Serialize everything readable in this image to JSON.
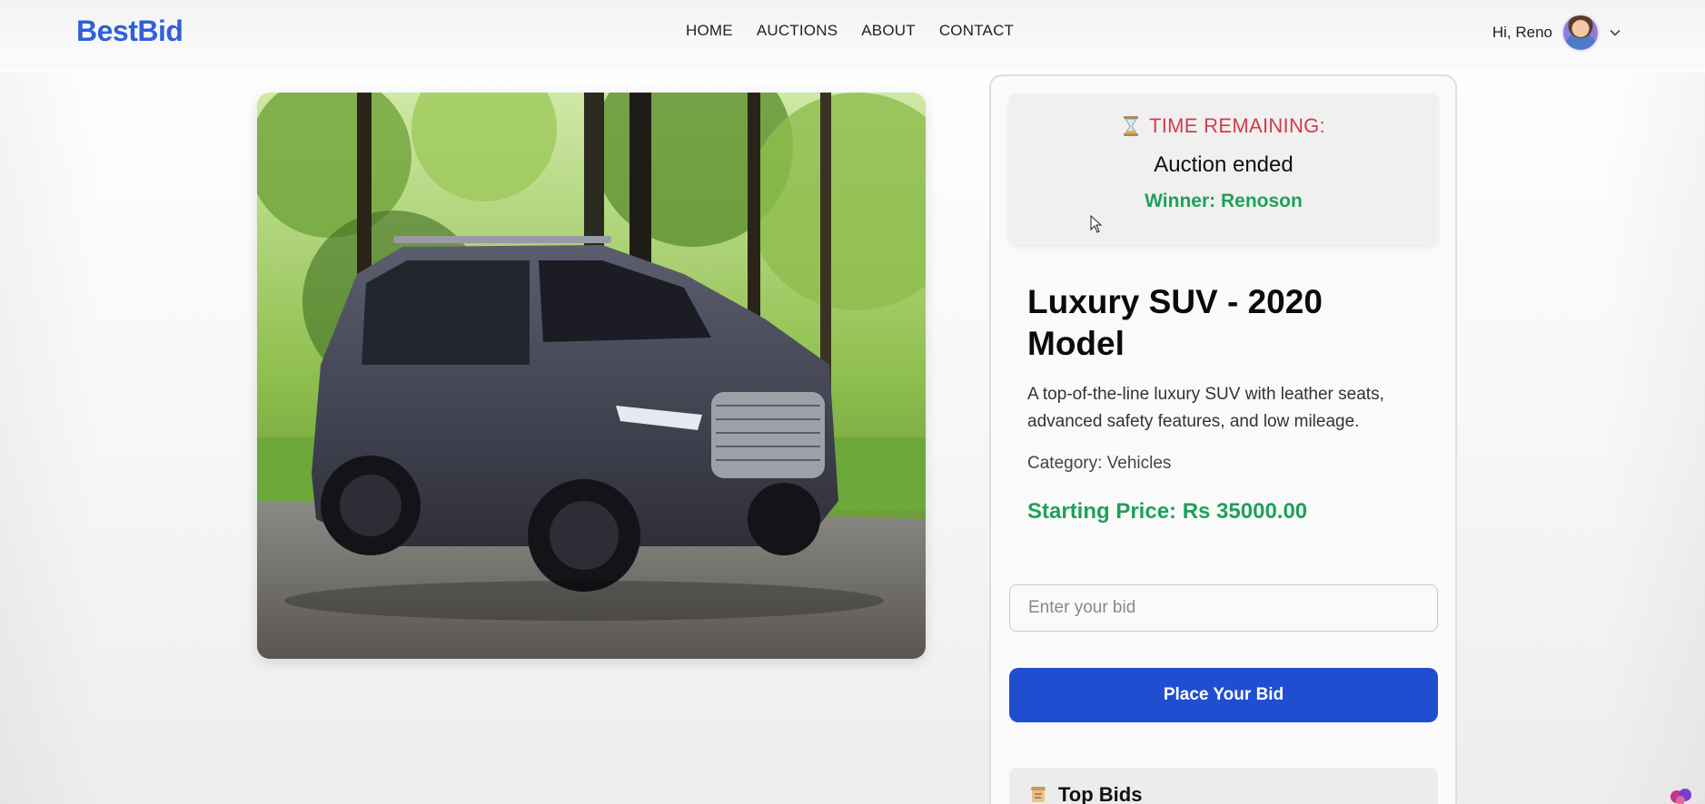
{
  "brand": {
    "logo": "BestBid",
    "accent": "#3060d8"
  },
  "nav": {
    "links": [
      "HOME",
      "AUCTIONS",
      "ABOUT",
      "CONTACT"
    ]
  },
  "user": {
    "greeting": "Hi, Reno",
    "avatar_icon": "user-avatar",
    "menu_icon": "chevron-down-icon"
  },
  "product": {
    "image_icon": "suv-photo",
    "title": "Luxury SUV - 2020 Model",
    "description": "A top-of-the-line luxury SUV with leather seats, advanced safety features, and low mileage.",
    "category": "Category: Vehicles",
    "starting_price": "Starting Price: Rs 35000.00"
  },
  "timer": {
    "icon": "hourglass-icon",
    "title": "TIME REMAINING:",
    "status": "Auction ended",
    "winner": "Winner: Renoson",
    "title_color": "#d23c4e",
    "winner_color": "#1fa15b"
  },
  "bid": {
    "placeholder": "Enter your bid",
    "button_label": "Place Your Bid",
    "button_color": "#1f4fd0"
  },
  "top_bids": {
    "icon": "scroll-icon",
    "label": "Top Bids"
  }
}
